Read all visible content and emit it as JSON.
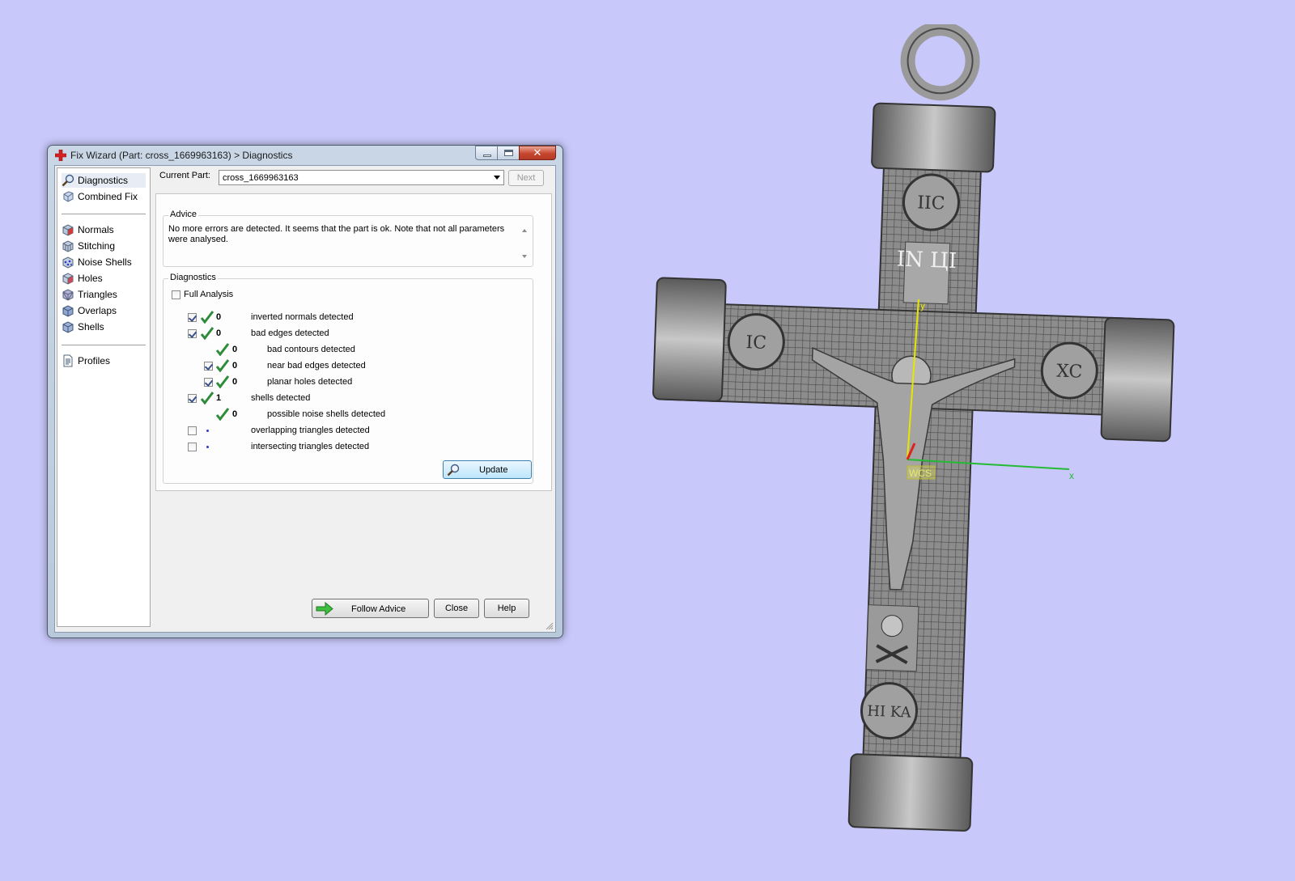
{
  "window": {
    "title": "Fix Wizard (Part: cross_1669963163) > Diagnostics",
    "close_glyph": "✕"
  },
  "nav": {
    "top_items": [
      {
        "label": "Diagnostics",
        "icon": "magnifier-icon"
      },
      {
        "label": "Combined Fix",
        "icon": "cube-icon"
      }
    ],
    "tool_items": [
      {
        "label": "Normals",
        "icon": "normals-cube-icon"
      },
      {
        "label": "Stitching",
        "icon": "stitching-cube-icon"
      },
      {
        "label": "Noise Shells",
        "icon": "noise-shells-icon"
      },
      {
        "label": "Holes",
        "icon": "holes-cube-icon"
      },
      {
        "label": "Triangles",
        "icon": "triangles-cube-icon"
      },
      {
        "label": "Overlaps",
        "icon": "overlaps-cube-icon"
      },
      {
        "label": "Shells",
        "icon": "shells-cube-icon"
      }
    ],
    "bottom_items": [
      {
        "label": "Profiles",
        "icon": "document-icon"
      }
    ]
  },
  "current_part": {
    "label": "Current Part:",
    "value": "cross_1669963163",
    "next_label": "Next"
  },
  "advice": {
    "group_title": "Advice",
    "text": "No more errors are detected. It seems that the part is ok. Note that not all parameters were analysed."
  },
  "diagnostics": {
    "group_title": "Diagnostics",
    "full_analysis_label": "Full Analysis",
    "full_analysis_checked": false,
    "rows": [
      {
        "checked": true,
        "status": "ok",
        "count": "0",
        "label": "inverted normals detected",
        "indent": 0
      },
      {
        "checked": true,
        "status": "ok",
        "count": "0",
        "label": "bad edges detected",
        "indent": 0
      },
      {
        "checked": null,
        "status": "ok",
        "count": "0",
        "label": "bad contours detected",
        "indent": 1
      },
      {
        "checked": true,
        "status": "ok",
        "count": "0",
        "label": "near bad edges detected",
        "indent": 1
      },
      {
        "checked": true,
        "status": "ok",
        "count": "0",
        "label": "planar holes detected",
        "indent": 1
      },
      {
        "checked": true,
        "status": "ok",
        "count": "1",
        "label": "shells detected",
        "indent": 0
      },
      {
        "checked": null,
        "status": "ok",
        "count": "0",
        "label": "possible noise shells detected",
        "indent": 1
      },
      {
        "checked": false,
        "status": "pending",
        "count": "",
        "label": "overlapping triangles detected",
        "indent": 0
      },
      {
        "checked": false,
        "status": "pending",
        "count": "",
        "label": "intersecting triangles detected",
        "indent": 0
      }
    ],
    "update_label": "Update"
  },
  "footer": {
    "follow_advice_label": "Follow Advice",
    "close_label": "Close",
    "help_label": "Help"
  },
  "viewport": {
    "top_plaque_text": "IN\nЦI",
    "medallions": [
      "IC",
      "XC",
      "HI\nKA",
      "IIC"
    ],
    "axis_x_label": "x",
    "axis_y_label": "y",
    "wcs_label": "WCS",
    "colors": {
      "background": "#c8c8fa",
      "model": "#8a8a8a",
      "axis_x": "#22bb33",
      "axis_y": "#e6e600",
      "axis_z": "#dd2222",
      "ok_tick": "#2e8b3a",
      "close_button": "#c7462f"
    }
  }
}
